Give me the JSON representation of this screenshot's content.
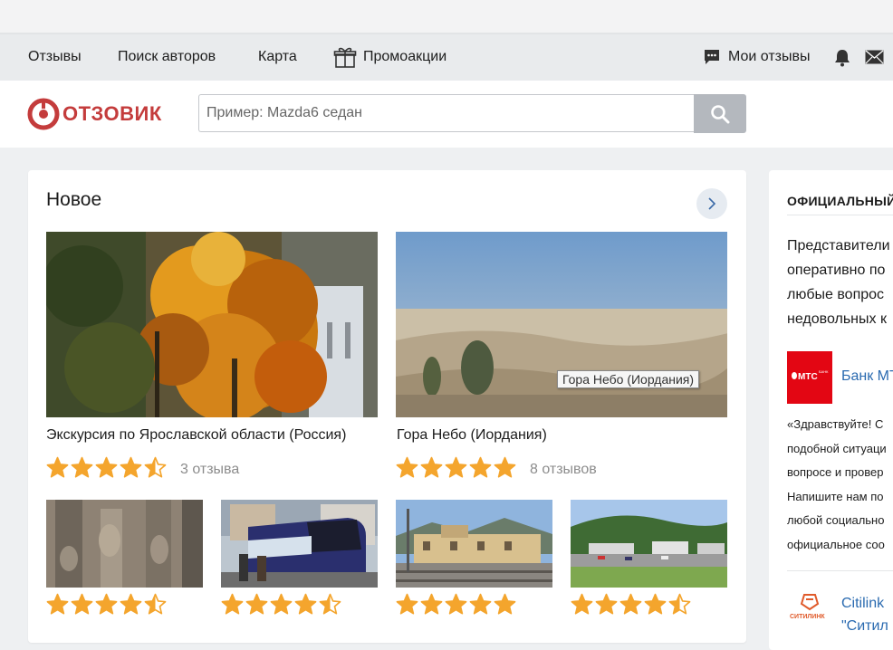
{
  "topnav": {
    "reviews": "Отзывы",
    "authors": "Поиск авторов",
    "map": "Карта",
    "promos": "Промоакции",
    "my_reviews": "Мои отзывы"
  },
  "header": {
    "logo_text": "ОТЗОВИК",
    "search_placeholder": "Пример: Mazda6 седан"
  },
  "main": {
    "section_title": "Новое",
    "featured": [
      {
        "title": "Экскурсия по Ярославской области (Россия)",
        "rating": 4.5,
        "reviews": "3 отзыва"
      },
      {
        "title": "Гора Небо (Иордания)",
        "rating": 5,
        "reviews": "8 отзывов"
      }
    ],
    "tooltip": "Гора Небо (Иордания)",
    "thumbs": [
      {
        "rating": 4.5
      },
      {
        "rating": 4.5
      },
      {
        "rating": 5
      },
      {
        "rating": 4.5
      }
    ]
  },
  "side": {
    "heading": "ОФИЦИАЛЬНЫЙ",
    "intro": [
      "Представители",
      "оперативно по",
      "любые вопрос",
      "недовольных к"
    ],
    "brand1": {
      "name": "Банк МТ",
      "tile": "МТС"
    },
    "quote": [
      "«Здравствуйте! С",
      "подобной ситуаци",
      "вопросе и провер",
      "Напишите нам по",
      "любой социально",
      "официальное соо"
    ],
    "brand2": {
      "line1": "Citilink",
      "line2": "\"Ситил",
      "logo_text": "СИТИЛИНК"
    }
  },
  "colors": {
    "accent": "#c43c3c",
    "star": "#f4a52d",
    "link": "#2a6ab0",
    "mts_red": "#e30613"
  }
}
